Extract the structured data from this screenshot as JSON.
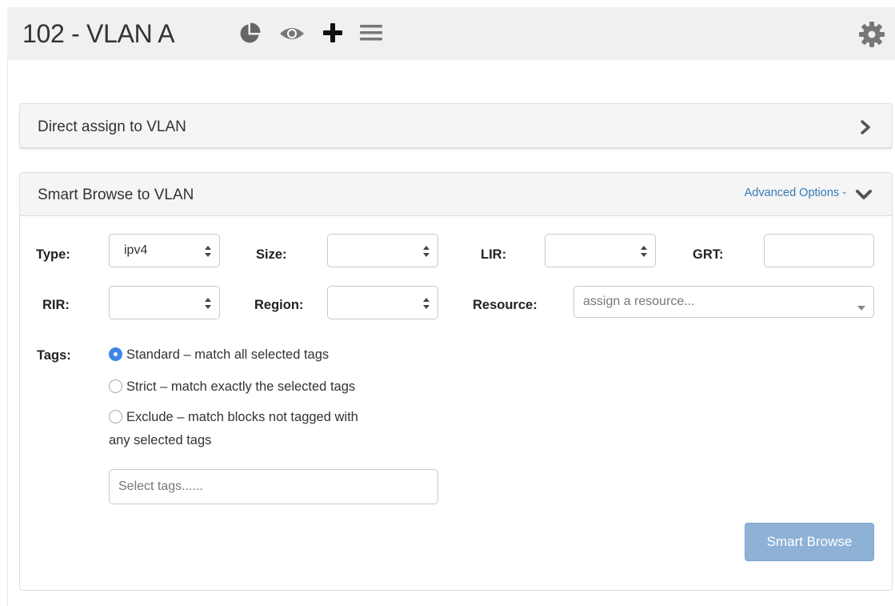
{
  "header": {
    "title": "102 - VLAN A",
    "icons": [
      "pie-chart-icon",
      "eye-icon",
      "plus-icon",
      "menu-icon",
      "gear-icon"
    ]
  },
  "direct_panel": {
    "title": "Direct assign to VLAN",
    "chevron_icon": "chevron-right-icon"
  },
  "smart_panel": {
    "title": "Smart Browse to VLAN",
    "advanced_link": "Advanced Options -",
    "chevron_icon": "chevron-down-icon",
    "form": {
      "type_label": "Type:",
      "type_value": "ipv4",
      "size_label": "Size:",
      "size_value": "",
      "lir_label": "LIR:",
      "lir_value": "",
      "grt_label": "GRT:",
      "grt_value": "",
      "rir_label": "RIR:",
      "rir_value": "",
      "region_label": "Region:",
      "region_value": "",
      "resource_label": "Resource:",
      "resource_placeholder": "assign a resource...",
      "tags_label": "Tags:",
      "tag_modes": [
        {
          "label": "Standard – match all selected tags",
          "selected": true
        },
        {
          "label": "Strict – match exactly the selected tags",
          "selected": false
        },
        {
          "label": "Exclude – match blocks not tagged with",
          "continuation": "any selected tags",
          "selected": false
        }
      ],
      "tags_placeholder": "Select tags......",
      "submit_label": "Smart Browse"
    }
  },
  "colors": {
    "header_bg": "#f0f0f0",
    "link": "#337ab7",
    "radio_selected": "#3d85e7",
    "button_bg": "#8eb2d6"
  }
}
